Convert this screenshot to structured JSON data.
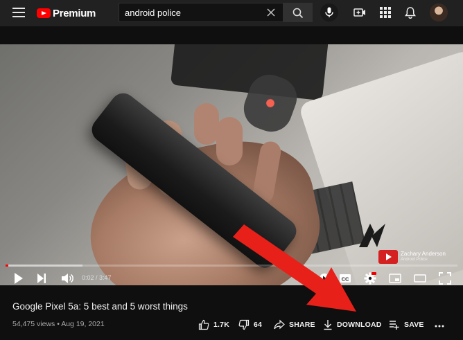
{
  "header": {
    "brand": "Premium",
    "search": {
      "value": "android police"
    }
  },
  "player": {
    "time": "0:02 / 3:47",
    "progress_fraction": 0.003,
    "buffered_fraction": 0.17,
    "credit_name": "Zachary Anderson",
    "credit_source": "Android Police"
  },
  "video": {
    "title": "Google Pixel 5a: 5 best and 5 worst things",
    "meta": "54,475 views • Aug 19, 2021",
    "actions": {
      "like": "1.7K",
      "dislike": "64",
      "share": "SHARE",
      "download": "DOWNLOAD",
      "save": "SAVE"
    }
  },
  "colors": {
    "accent": "#ff0000",
    "annotation_arrow": "#e8201a"
  }
}
